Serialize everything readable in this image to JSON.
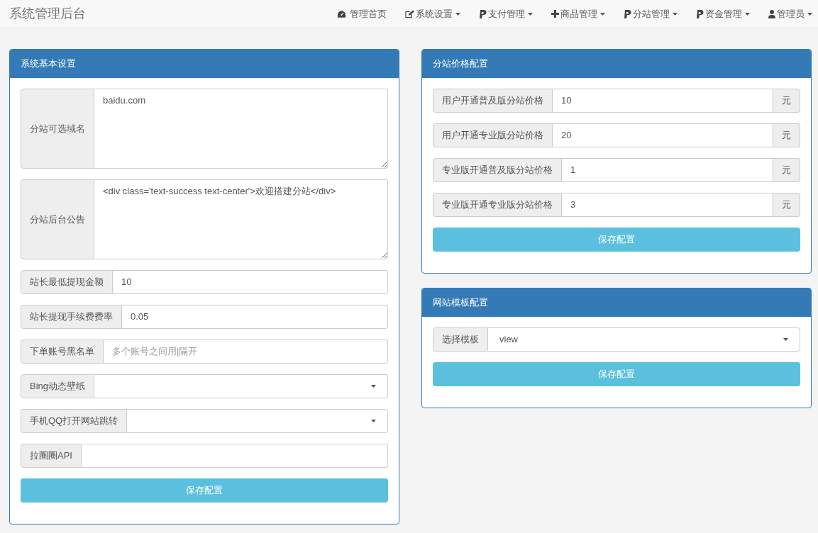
{
  "navbar": {
    "brand": "系统管理后台",
    "items": [
      {
        "kind": "dashboard",
        "label": "管理首页",
        "dropdown": false
      },
      {
        "kind": "edit",
        "label": "系统设置",
        "dropdown": true
      },
      {
        "kind": "pay",
        "label": "支付管理",
        "dropdown": true
      },
      {
        "kind": "plus",
        "label": "商品管理",
        "dropdown": true
      },
      {
        "kind": "pay",
        "label": "分站管理",
        "dropdown": true
      },
      {
        "kind": "pay",
        "label": "资金管理",
        "dropdown": true
      },
      {
        "kind": "user",
        "label": "管理员",
        "dropdown": true
      }
    ]
  },
  "columns": [
    {
      "panels": [
        {
          "title": "系统基本设置",
          "fields": [
            {
              "kind": "textarea",
              "label": "分站可选域名",
              "value": "baidu.com"
            },
            {
              "kind": "textarea",
              "label": "分站后台公告",
              "value": "<div class='text-success text-center'>欢迎搭建分站</div>"
            },
            {
              "kind": "input",
              "label": "站长最低提现金额",
              "value": "10"
            },
            {
              "kind": "input",
              "label": "站长提现手续费费率",
              "value": "0.05"
            },
            {
              "kind": "input",
              "label": "下单账号黑名单",
              "placeholder": "多个账号之间用|隔开"
            },
            {
              "kind": "select",
              "label": "Bing动态壁纸"
            },
            {
              "kind": "select",
              "label": "手机QQ打开网站跳转"
            },
            {
              "kind": "input",
              "label": "拉圈圈API"
            }
          ],
          "button": "保存配置"
        }
      ]
    },
    {
      "panels": [
        {
          "title": "分站价格配置",
          "fields": [
            {
              "kind": "input",
              "label": "用户开通普及版分站价格",
              "value": "10",
              "addon": "元"
            },
            {
              "kind": "input",
              "label": "用户开通专业版分站价格",
              "value": "20",
              "addon": "元"
            },
            {
              "kind": "input",
              "label": "专业版开通普及版分站价格",
              "value": "1",
              "addon": "元"
            },
            {
              "kind": "input",
              "label": "专业版开通专业版分站价格",
              "value": "3",
              "addon": "元"
            }
          ],
          "button": "保存配置"
        },
        {
          "title": "网站模板配置",
          "fields": [
            {
              "kind": "select",
              "label": "选择模板",
              "value": "view"
            }
          ],
          "button": "保存配置"
        }
      ]
    }
  ]
}
